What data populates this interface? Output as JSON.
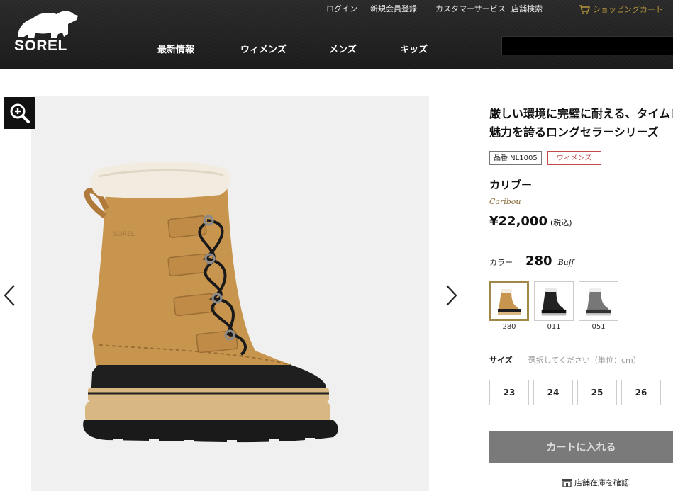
{
  "header": {
    "logo_text": "SOREL",
    "util_links": [
      "ログイン",
      "新規会員登録",
      "カスタマーサービス",
      "店舗検索"
    ],
    "cart_label": "ショッピングカート",
    "nav": [
      "最新情報",
      "ウィメンズ",
      "メンズ",
      "キッズ"
    ]
  },
  "product": {
    "tagline_1": "厳しい環境に完璧に耐える、タイムレ",
    "tagline_2": "魅力を誇るロングセラーシリーズ",
    "sku_badge": "品番 NL1005",
    "gender_badge": "ウィメンズ",
    "name_jp": "カリブー",
    "name_en": "Caribou",
    "price": "¥22,000",
    "tax_note": "(税込)",
    "color_label": "カラー",
    "color_code": "280",
    "color_name": "Buff",
    "swatches": [
      {
        "code": "280",
        "selected": true,
        "color": "#c8954f"
      },
      {
        "code": "011",
        "selected": false,
        "color": "#222222"
      },
      {
        "code": "051",
        "selected": false,
        "color": "#777777"
      }
    ],
    "size_label": "サイズ",
    "size_hint": "選択してください（単位：cm）",
    "sizes": [
      "23",
      "24",
      "25",
      "26"
    ],
    "cart_button": "カートに入れる",
    "store_stock": "店舗在庫を確認"
  },
  "colors": {
    "header_bg": "#1f1f1f",
    "gold": "#b8973c",
    "cart_btn": "#7a7a7a",
    "swatch_selected_border": "#a08848"
  }
}
